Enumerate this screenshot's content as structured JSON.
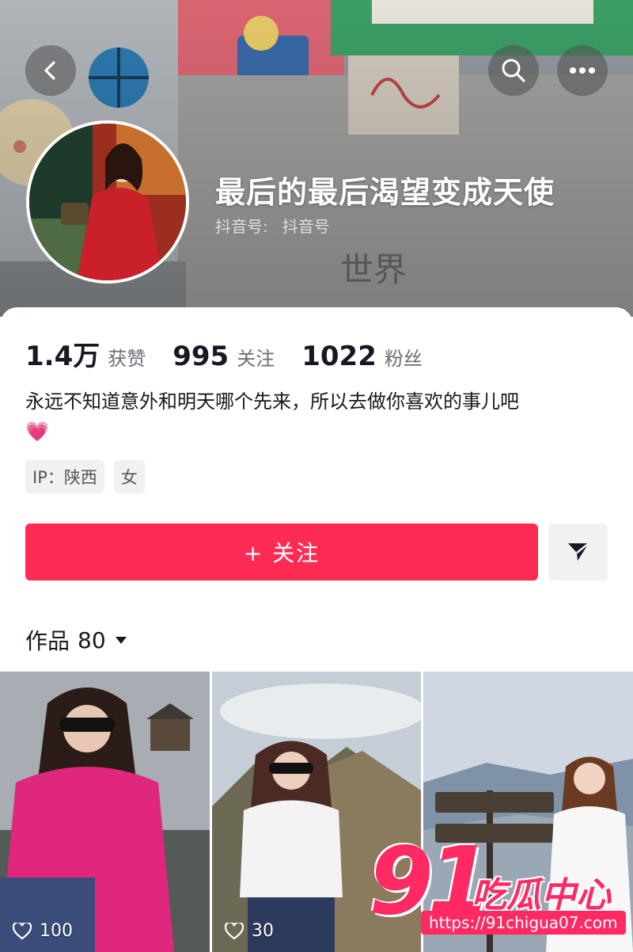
{
  "profile": {
    "nickname": "最后的最后渴望变成天使",
    "douyin_id_label": "抖音号:",
    "douyin_id_value": "抖音号"
  },
  "stats": [
    {
      "value": "1.4万",
      "label": "获赞"
    },
    {
      "value": "995",
      "label": "关注"
    },
    {
      "value": "1022",
      "label": "粉丝"
    }
  ],
  "bio": {
    "text": "永远不知道意外和明天哪个先来，所以去做你喜欢的事儿吧",
    "emoji": "💗"
  },
  "tags": [
    "IP：陕西",
    "女"
  ],
  "actions": {
    "follow_label": "+ 关注"
  },
  "works": {
    "label": "作品",
    "count": "80"
  },
  "videos": [
    {
      "likes": "100"
    },
    {
      "likes": "30"
    },
    {
      "likes": ""
    }
  ],
  "watermark": {
    "number": "91",
    "text": "吃瓜中心",
    "url": "https://91chigua07.com"
  },
  "colors": {
    "accent": "#fe2c55",
    "watermark": "#ff2a63"
  }
}
